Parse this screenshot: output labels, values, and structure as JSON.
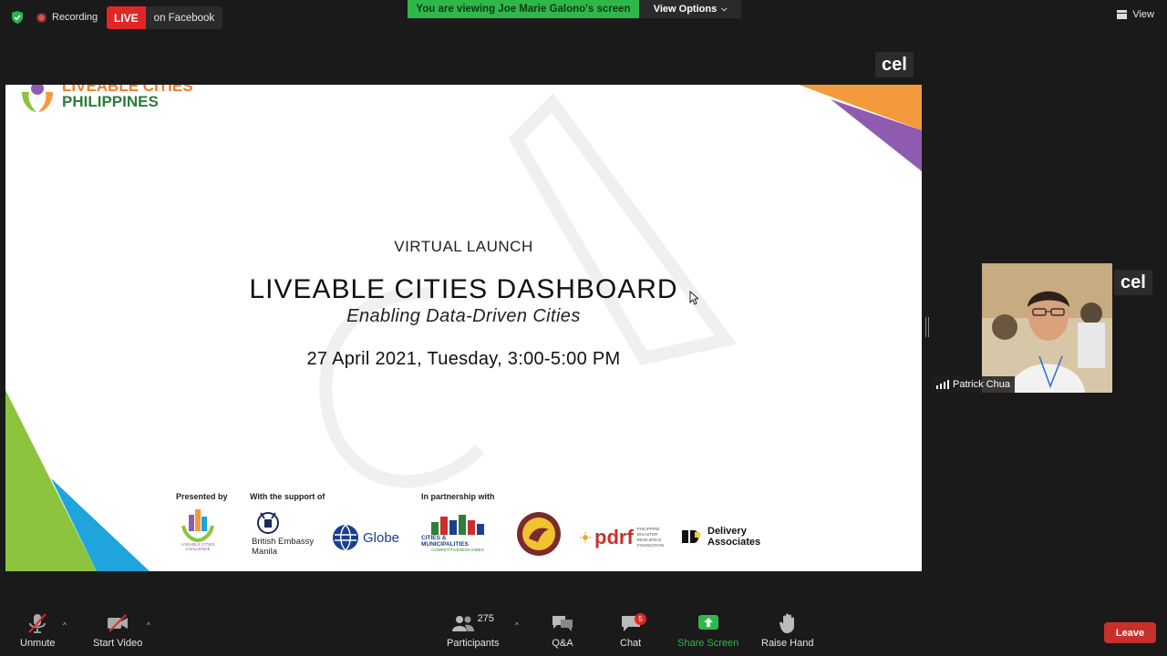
{
  "topbar": {
    "recording_label": "Recording",
    "live_badge": "LIVE",
    "live_target": "on Facebook",
    "viewing_banner": "You are viewing Joe Marie Galono's screen",
    "view_options": "View Options",
    "view_label": "View"
  },
  "cel_tags": {
    "top": "cel",
    "side": "cel"
  },
  "slide": {
    "brand_line1": "LIVEABLE CITIES",
    "brand_line2": "PHILIPPINES",
    "virtual_launch": "VIRTUAL LAUNCH",
    "title": "LIVEABLE CITIES DASHBOARD",
    "subtitle": "Enabling Data-Driven Cities",
    "date": "27 April 2021, Tuesday, 3:00-5:00 PM",
    "presented_by": "Presented by",
    "support_of": "With the support of",
    "partnership_with": "In partnership with",
    "logo_liveable": "LIVEABLE CITIES CHALLENGE",
    "logo_british_1": "British Embassy",
    "logo_british_2": "Manila",
    "logo_globe": "Globe",
    "logo_cmci_1": "CITIES & MUNICIPALITIES",
    "logo_cmci_2": "COMPETITIVENESS INDEX",
    "logo_pdrf": "pdrf",
    "logo_pdrf_sub": "PHILIPPINE DISASTER RESILIENCE FOUNDATION",
    "logo_delivery_1": "Delivery",
    "logo_delivery_2": "Associates"
  },
  "participant": {
    "name": "Patrick Chua"
  },
  "toolbar": {
    "unmute": "Unmute",
    "start_video": "Start Video",
    "participants": "Participants",
    "participant_count": "275",
    "qa": "Q&A",
    "chat": "Chat",
    "chat_badge": "5",
    "share_screen": "Share Screen",
    "raise_hand": "Raise Hand",
    "leave": "Leave"
  },
  "colors": {
    "share_green": "#2fb84a",
    "live_red": "#e02727",
    "leave_red": "#c9302c"
  }
}
